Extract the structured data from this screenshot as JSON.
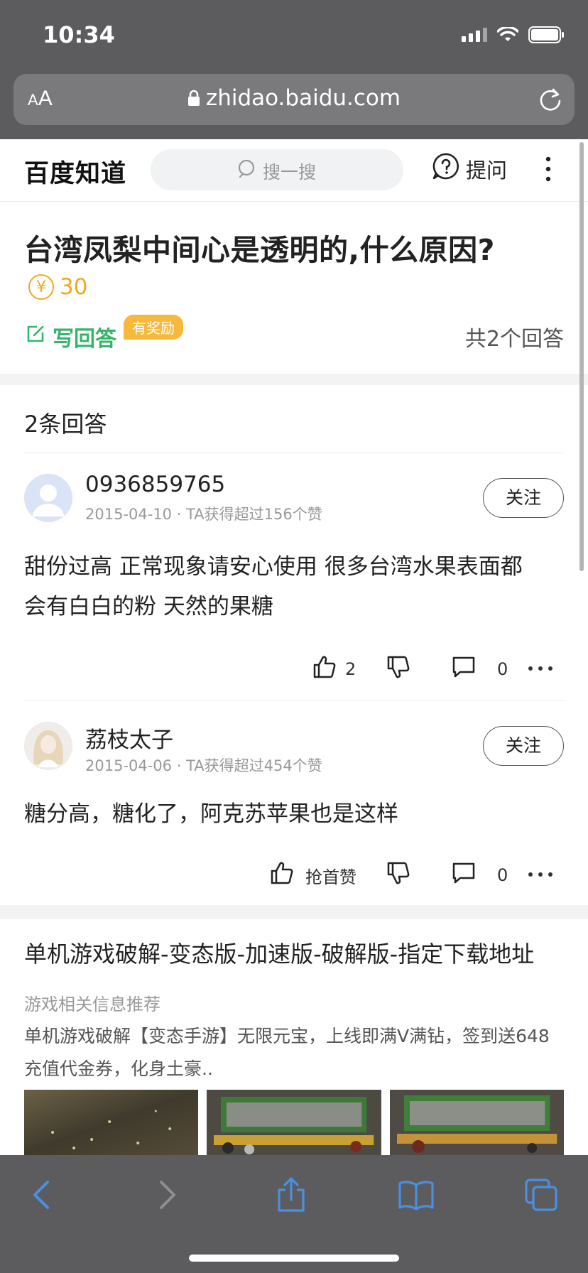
{
  "status_bar": {
    "time": "10:34"
  },
  "browser": {
    "text_size_label_small": "A",
    "text_size_label_large": "A",
    "url": "zhidao.baidu.com"
  },
  "header": {
    "logo": "百度知道",
    "search_placeholder": "搜一搜",
    "ask_label": "提问"
  },
  "question": {
    "title": "台湾凤梨中间心是透明的,什么原因?",
    "reward": "30",
    "write_answer_label": "写回答",
    "reward_badge": "有奖励",
    "answer_total": "共2个回答"
  },
  "answers_heading": "2条回答",
  "answers": [
    {
      "user_name": "0936859765",
      "date": "2015-04-10",
      "separator": "·",
      "likes_info": "TA获得超过156个赞",
      "follow_label": "关注",
      "text_line1": "甜份过高 正常现象请安心使用 很多台湾水果表面都",
      "text_line2": "会有白白的粉 天然的果糖",
      "like_count": "2",
      "comment_count": "0"
    },
    {
      "user_name": "荔枝太子",
      "date": "2015-04-06",
      "separator": "·",
      "likes_info": "TA获得超过454个赞",
      "follow_label": "关注",
      "text_line1": "糖分高，糖化了，阿克苏苹果也是这样",
      "like_label": "抢首赞",
      "comment_count": "0"
    }
  ],
  "ad": {
    "title": "单机游戏破解-变态版-加速版-破解版-指定下载地址",
    "source": "游戏相关信息推荐",
    "desc_line1": "单机游戏破解【变态手游】无限元宝，上线即满V满钻，签到送648",
    "desc_line2": "充值代金券，化身土豪.."
  },
  "colors": {
    "brand_green": "#35b56a",
    "reward_orange": "#f0a91e",
    "safari_chrome": "#5c5c5e",
    "link_blue": "#4a90e2"
  },
  "icons": [
    "lock-icon",
    "reload-icon",
    "search-icon",
    "question-icon",
    "more-vertical-icon",
    "yen-icon",
    "edit-icon",
    "thumbs-up-icon",
    "thumbs-down-icon",
    "comment-icon",
    "more-horizontal-icon",
    "back-icon",
    "forward-icon",
    "share-icon",
    "bookmarks-icon",
    "tabs-icon"
  ]
}
